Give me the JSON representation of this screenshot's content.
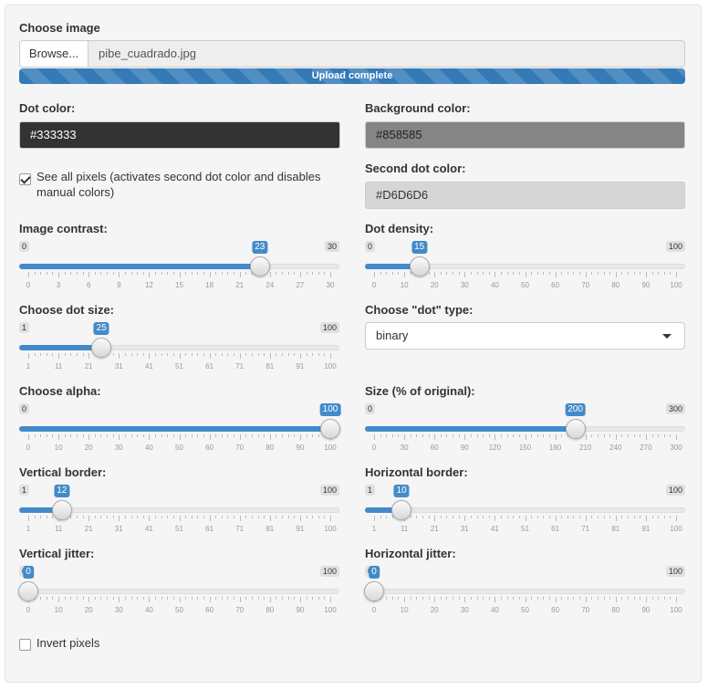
{
  "file": {
    "label": "Choose image",
    "browse_label": "Browse...",
    "file_name": "pibe_cuadrado.jpg",
    "progress_text": "Upload complete",
    "progress": 1.0
  },
  "dot_color": {
    "label": "Dot color:",
    "value": "#333333",
    "bg": "#333333",
    "fg": "#ffffff"
  },
  "background_color": {
    "label": "Background color:",
    "value": "#858585",
    "bg": "#858585",
    "fg": "#222222"
  },
  "second_dot_color": {
    "label": "Second dot color:",
    "value": "#D6D6D6",
    "bg": "#D6D6D6",
    "fg": "#333333"
  },
  "see_all_pixels": {
    "label": "See all pixels (activates second dot color and disables manual colors)",
    "checked": true
  },
  "dot_type": {
    "label": "Choose \"dot\" type:",
    "value": "binary"
  },
  "invert_pixels": {
    "label": "Invert pixels",
    "checked": false
  },
  "sliders": [
    {
      "id": "image-contrast",
      "label": "Image contrast:",
      "min": 0,
      "max": 30,
      "value": 23,
      "ticks": [
        "0",
        "3",
        "6",
        "9",
        "12",
        "15",
        "18",
        "21",
        "24",
        "27",
        "30"
      ]
    },
    {
      "id": "dot-density",
      "label": "Dot density:",
      "min": 0,
      "max": 100,
      "value": 15,
      "ticks": [
        "0",
        "10",
        "20",
        "30",
        "40",
        "50",
        "60",
        "70",
        "80",
        "90",
        "100"
      ]
    },
    {
      "id": "dot-size",
      "label": "Choose dot size:",
      "min": 1,
      "max": 100,
      "value": 25,
      "ticks": [
        "1",
        "11",
        "21",
        "31",
        "41",
        "51",
        "61",
        "71",
        "81",
        "91",
        "100"
      ]
    },
    {
      "id": "alpha",
      "label": "Choose alpha:",
      "min": 0,
      "max": 100,
      "value": 100,
      "ticks": [
        "0",
        "10",
        "20",
        "30",
        "40",
        "50",
        "60",
        "70",
        "80",
        "90",
        "100"
      ]
    },
    {
      "id": "size-percent",
      "label": "Size (% of original):",
      "min": 0,
      "max": 300,
      "value": 200,
      "ticks": [
        "0",
        "30",
        "60",
        "90",
        "120",
        "150",
        "180",
        "210",
        "240",
        "270",
        "300"
      ]
    },
    {
      "id": "vertical-border",
      "label": "Vertical border:",
      "min": 1,
      "max": 100,
      "value": 12,
      "ticks": [
        "1",
        "11",
        "21",
        "31",
        "41",
        "51",
        "61",
        "71",
        "81",
        "91",
        "100"
      ]
    },
    {
      "id": "horizontal-border",
      "label": "Horizontal border:",
      "min": 1,
      "max": 100,
      "value": 10,
      "ticks": [
        "1",
        "11",
        "21",
        "31",
        "41",
        "51",
        "61",
        "71",
        "81",
        "91",
        "100"
      ]
    },
    {
      "id": "vertical-jitter",
      "label": "Vertical jitter:",
      "min": 0,
      "max": 100,
      "value": 0,
      "ticks": [
        "0",
        "10",
        "20",
        "30",
        "40",
        "50",
        "60",
        "70",
        "80",
        "90",
        "100"
      ]
    },
    {
      "id": "horizontal-jitter",
      "label": "Horizontal jitter:",
      "min": 0,
      "max": 100,
      "value": 0,
      "ticks": [
        "0",
        "10",
        "20",
        "30",
        "40",
        "50",
        "60",
        "70",
        "80",
        "90",
        "100"
      ]
    }
  ],
  "accent_color": "#428bca"
}
